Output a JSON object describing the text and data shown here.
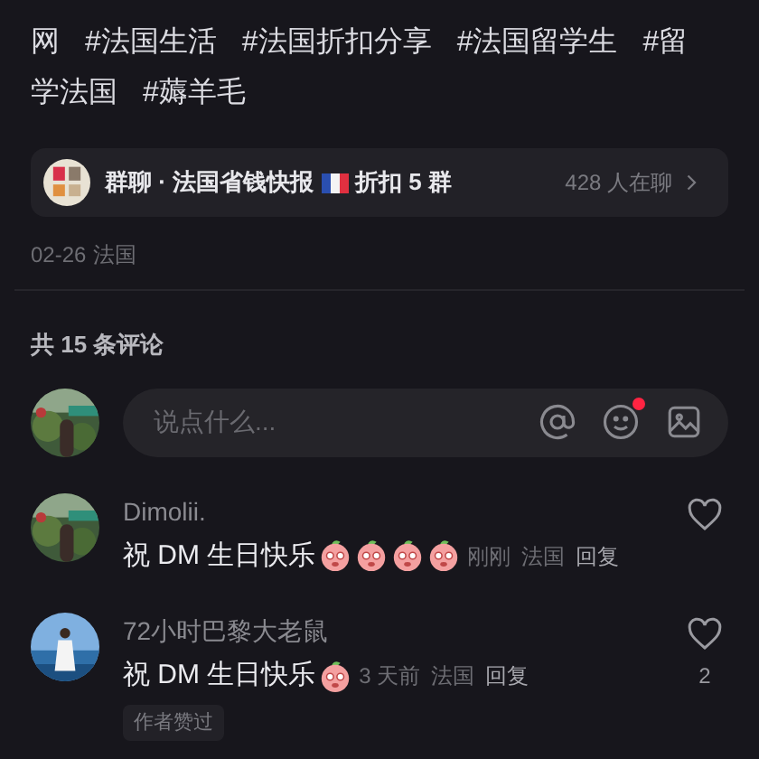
{
  "post": {
    "tag_lines": [
      [
        "网",
        "#法国生活",
        "#法国折扣分享",
        "#法国留学生",
        "#留"
      ],
      [
        "学法国",
        "#薅羊毛"
      ]
    ],
    "group_chat": {
      "prefix": "群聊 · 法国省钱快报",
      "suffix": "折扣 5 群",
      "members": "428 人在聊"
    },
    "date": "02-26",
    "location": "法国"
  },
  "comments_header": "共 15 条评论",
  "comment_input": {
    "placeholder": "说点什么...",
    "emoji_unread": true
  },
  "comments": [
    {
      "name": "Dimolii.",
      "text": "祝 DM 生日快乐",
      "stickers": [
        {
          "kind": "peach"
        },
        {
          "kind": "peach"
        },
        {
          "kind": "peach"
        },
        {
          "kind": "peach"
        }
      ],
      "time": "刚刚",
      "location": "法国",
      "reply": "回复"
    },
    {
      "name": "72小时巴黎大老鼠",
      "text": "祝 DM 生日快乐",
      "stickers": [
        {
          "kind": "peach"
        }
      ],
      "time": "3 天前",
      "location": "法国",
      "reply": "回复",
      "likes": "2",
      "author_liked_label": "作者赞过"
    }
  ]
}
